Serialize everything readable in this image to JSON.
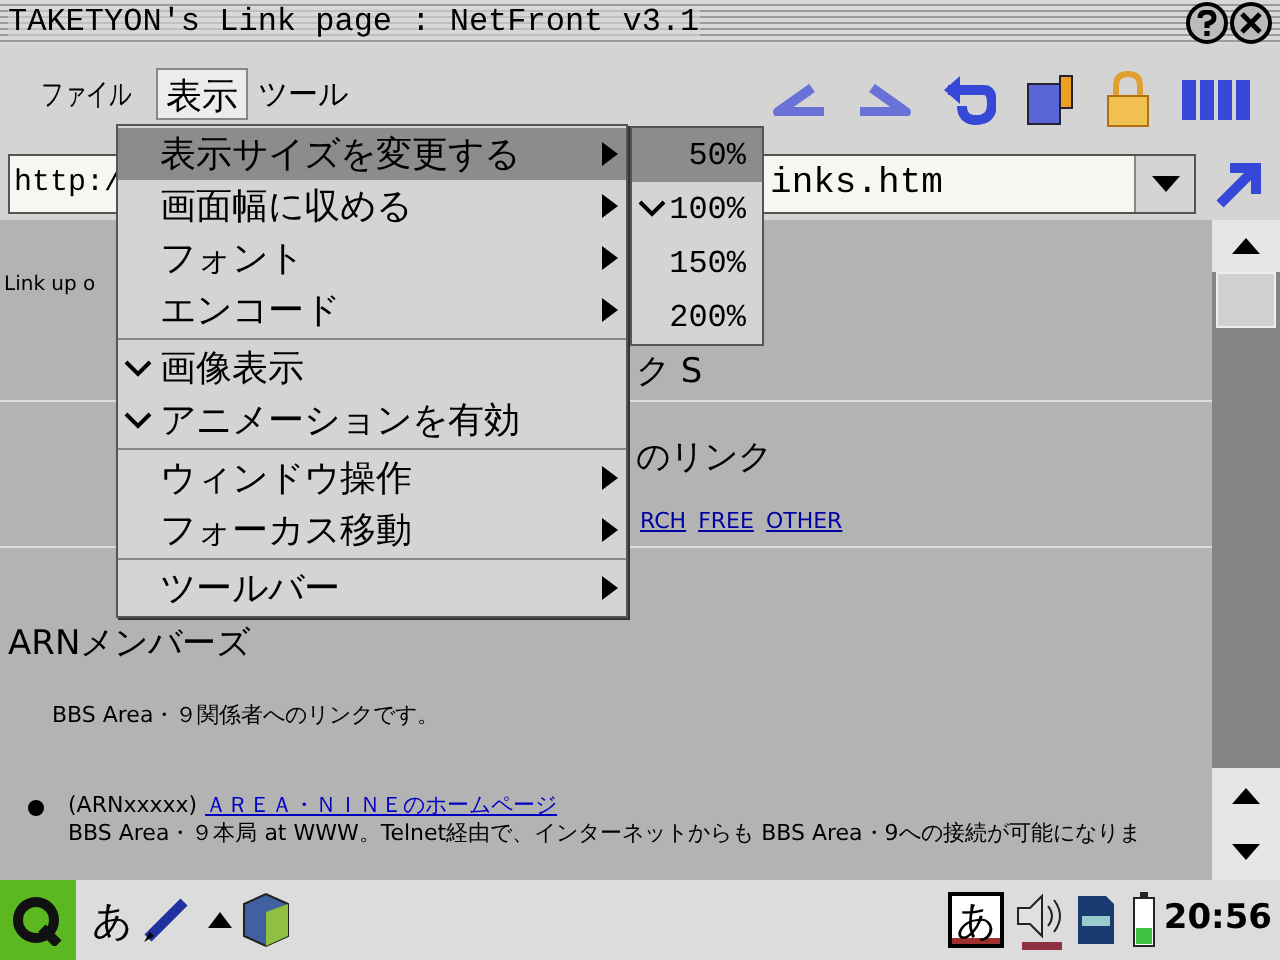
{
  "window": {
    "title": "TAKETYON's Link page : NetFront v3.1"
  },
  "menubar": [
    {
      "label": "ファイル",
      "selected": false
    },
    {
      "label": "表示",
      "selected": true
    },
    {
      "label": "ツール",
      "selected": false
    }
  ],
  "url": {
    "left": "http:/",
    "right": "inks.htm"
  },
  "page": {
    "update_note": "Link up o",
    "heading_fragment": "ク S",
    "links_heading_fragment": "のリンク",
    "nav_links": [
      "RCH",
      "FREE",
      "OTHER"
    ],
    "section_title": "ARNメンバーズ",
    "section_desc": "BBS Area・９関係者へのリンクです。",
    "entries": [
      {
        "prefix": "(ARNxxxxx)",
        "link": "ＡＲＥＡ・ＮＩＮＥのホームページ",
        "desc": "BBS Area・９本局 at WWW。Telnet経由で、インターネットからも BBS Area・9への接続が可能になりま"
      }
    ]
  },
  "menu": [
    {
      "kind": "item",
      "label": "表示サイズを変更する",
      "selected": true,
      "checked": false,
      "submenu": true
    },
    {
      "kind": "item",
      "label": "画面幅に収める",
      "selected": false,
      "checked": false,
      "submenu": true
    },
    {
      "kind": "item",
      "label": "フォント",
      "selected": false,
      "checked": false,
      "submenu": true
    },
    {
      "kind": "item",
      "label": "エンコード",
      "selected": false,
      "checked": false,
      "submenu": true
    },
    {
      "kind": "separator"
    },
    {
      "kind": "item",
      "label": "画像表示",
      "selected": false,
      "checked": true,
      "submenu": false
    },
    {
      "kind": "item",
      "label": "アニメーションを有効",
      "selected": false,
      "checked": true,
      "submenu": false
    },
    {
      "kind": "separator"
    },
    {
      "kind": "item",
      "label": "ウィンドウ操作",
      "selected": false,
      "checked": false,
      "submenu": true
    },
    {
      "kind": "item",
      "label": "フォーカス移動",
      "selected": false,
      "checked": false,
      "submenu": true
    },
    {
      "kind": "separator"
    },
    {
      "kind": "item",
      "label": "ツールバー",
      "selected": false,
      "checked": false,
      "submenu": true
    }
  ],
  "submenu": [
    {
      "label": "50%",
      "selected": true,
      "checked": false
    },
    {
      "label": "100%",
      "selected": false,
      "checked": true
    },
    {
      "label": "150%",
      "selected": false,
      "checked": false
    },
    {
      "label": "200%",
      "selected": false,
      "checked": false
    }
  ],
  "taskbar": {
    "input_mode": "あ",
    "tray_input_mode": "あ",
    "clock": "20:56"
  }
}
